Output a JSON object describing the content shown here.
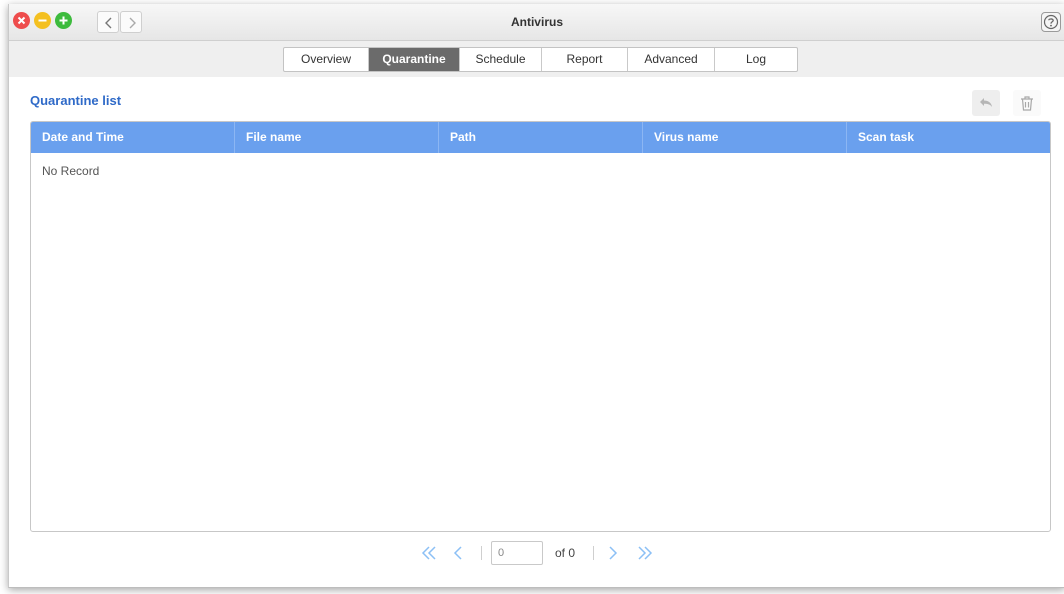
{
  "window": {
    "title": "Antivirus"
  },
  "tabs": [
    {
      "label": "Overview",
      "active": false
    },
    {
      "label": "Quarantine",
      "active": true
    },
    {
      "label": "Schedule",
      "active": false
    },
    {
      "label": "Report",
      "active": false
    },
    {
      "label": "Advanced",
      "active": false
    },
    {
      "label": "Log",
      "active": false
    }
  ],
  "main": {
    "section_title": "Quarantine list",
    "toolbar_icons": [
      "restore-icon",
      "trash-icon"
    ]
  },
  "table": {
    "columns": [
      "Date and Time",
      "File name",
      "Path",
      "Virus name",
      "Scan task"
    ],
    "empty_text": "No Record"
  },
  "pager": {
    "page_value": "0",
    "of_text": "of 0"
  },
  "colors": {
    "accent": "#2f6ac8",
    "table_header": "#6aa0ee",
    "active_tab": "#6b6b6b",
    "pager_icon": "#8cc0f5"
  }
}
